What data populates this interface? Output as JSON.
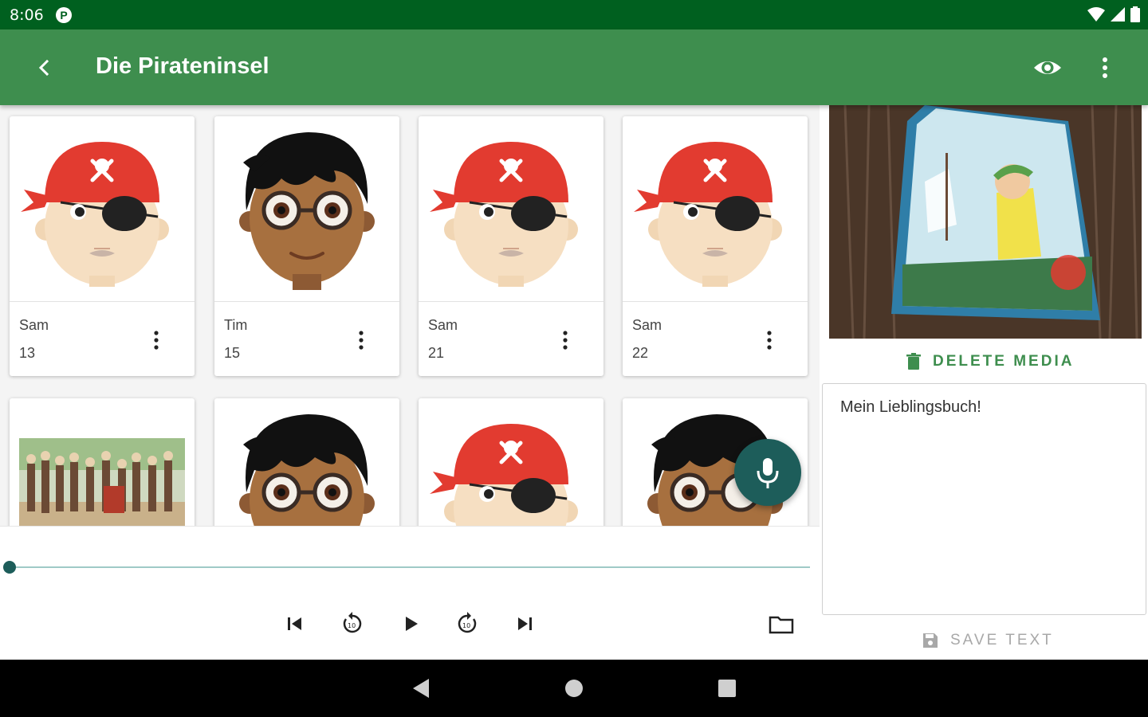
{
  "status_bar": {
    "time": "8:06",
    "notification_icon": "P"
  },
  "app_bar": {
    "title": "Die Pirateninsel",
    "icons": [
      "back-icon",
      "eye-icon",
      "more-vert-icon"
    ]
  },
  "cards": [
    {
      "name": "Sam",
      "number": "13",
      "avatar": "pirate"
    },
    {
      "name": "Tim",
      "number": "15",
      "avatar": "boy"
    },
    {
      "name": "Sam",
      "number": "21",
      "avatar": "pirate"
    },
    {
      "name": "Sam",
      "number": "22",
      "avatar": "pirate"
    }
  ],
  "cards_row2": [
    "photo",
    "boy",
    "pirate",
    "boy"
  ],
  "player": {
    "progress": 0
  },
  "side_panel": {
    "delete_label": "DELETE MEDIA",
    "text_content": "Mein Lieblingsbuch!",
    "save_label": "SAVE TEXT"
  },
  "colors": {
    "status_bar": "#00601f",
    "app_bar": "#3e8e4e",
    "accent": "#1d5d5a",
    "delete_text": "#3e8e4e"
  }
}
